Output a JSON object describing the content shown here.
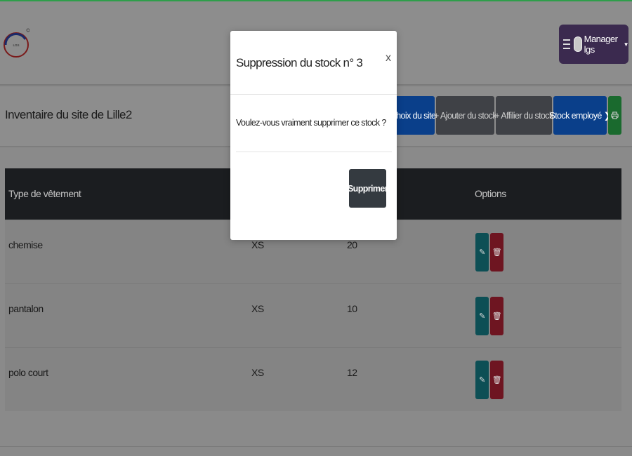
{
  "navbar": {
    "user_menu_label": "Manager lgs"
  },
  "page": {
    "title": "Inventaire du site de Lille2",
    "buttons": {
      "site_choice": "Choix du site",
      "add_stock": "+ Ajouter du stock",
      "assign_stock": "+ Affilier du stock",
      "employee_stock": "Stock employé ❯"
    }
  },
  "table": {
    "headers": {
      "type": "Type de vêtement",
      "options": "Options"
    },
    "rows": [
      {
        "type": "chemise",
        "size": "XS",
        "qty": "20"
      },
      {
        "type": "pantalon",
        "size": "XS",
        "qty": "10"
      },
      {
        "type": "polo court",
        "size": "XS",
        "qty": "12"
      }
    ]
  },
  "modal": {
    "title": "Suppression du stock n° 3",
    "close": "x",
    "body": "Voulez-vous vraiment supprimer ce stock ?",
    "confirm": "Supprimer"
  },
  "colors": {
    "accent": "#28a745",
    "brand_purple": "#6f42c1",
    "primary": "#0d6efd",
    "danger": "#dc3545",
    "info": "#17a2b8",
    "dark": "#343a40"
  }
}
